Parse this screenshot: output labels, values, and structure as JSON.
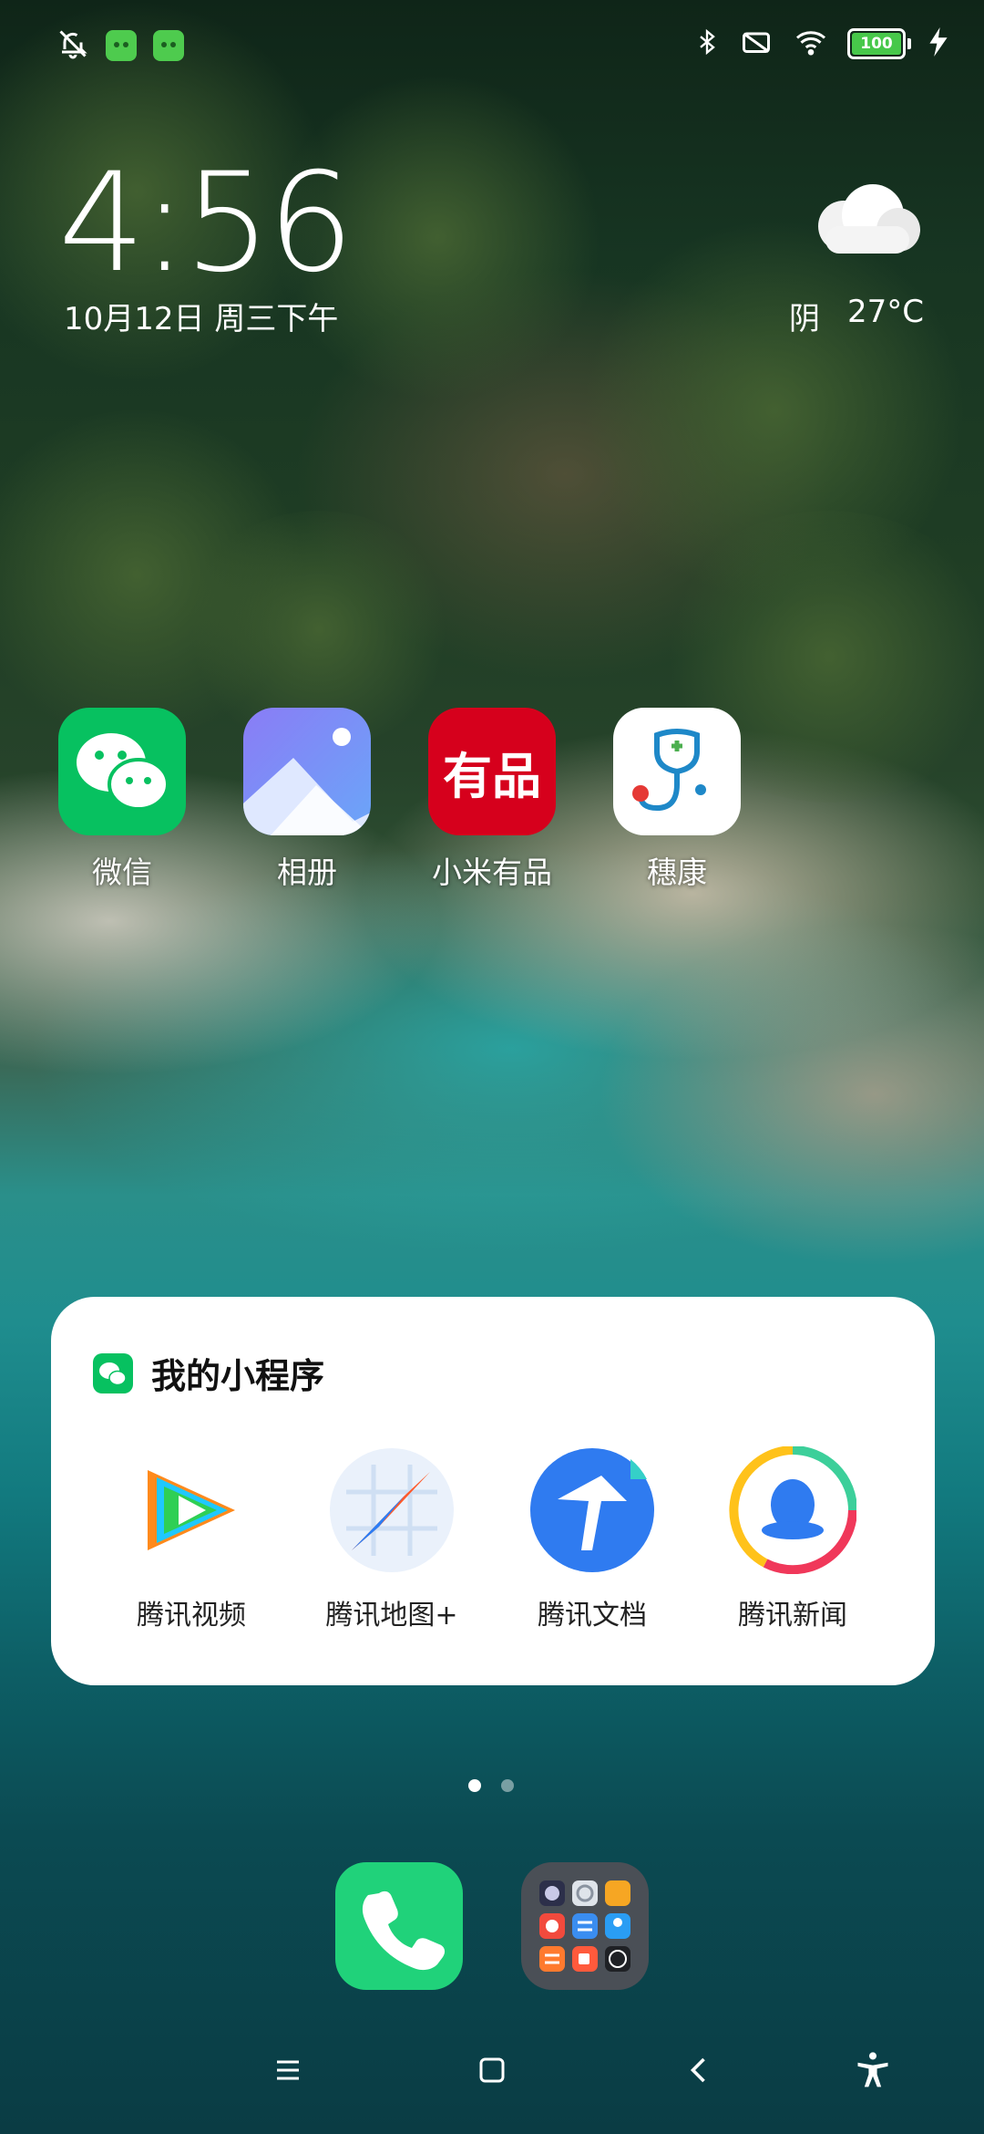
{
  "status_bar": {
    "icons_left": [
      "bell-off-icon",
      "android-icon",
      "android-icon"
    ],
    "icons_right": [
      "bluetooth-icon",
      "no-sim-icon",
      "wifi-icon",
      "battery-icon",
      "charging-icon"
    ],
    "battery_level": "100"
  },
  "clock": {
    "time": "4:56",
    "date": "10月12日 周三下午"
  },
  "weather": {
    "condition": "阴",
    "temperature": "27°C",
    "icon": "cloud-icon"
  },
  "apps": [
    {
      "label": "微信",
      "icon": "wechat-icon",
      "color": "#07c160"
    },
    {
      "label": "相册",
      "icon": "gallery-icon",
      "color": "#7b7ff2"
    },
    {
      "label": "小米有品",
      "icon": "youpin-icon",
      "color": "#d6001c",
      "icon_text": "有品"
    },
    {
      "label": "穗康",
      "icon": "suikang-icon",
      "color": "#ffffff"
    }
  ],
  "widget": {
    "title": "我的小程序",
    "items": [
      {
        "label": "腾讯视频",
        "icon": "tencent-video-icon"
      },
      {
        "label": "腾讯地图+",
        "icon": "tencent-map-icon"
      },
      {
        "label": "腾讯文档",
        "icon": "tencent-docs-icon"
      },
      {
        "label": "腾讯新闻",
        "icon": "tencent-news-icon"
      }
    ]
  },
  "pages": {
    "count": 2,
    "active": 0
  },
  "dock": [
    {
      "name": "phone",
      "icon": "phone-icon",
      "color": "#20d27a"
    },
    {
      "name": "folder",
      "icon": "app-folder-icon",
      "color": "#4a4f56"
    }
  ],
  "nav": [
    "menu-icon",
    "home-icon",
    "back-icon",
    "accessibility-icon"
  ]
}
